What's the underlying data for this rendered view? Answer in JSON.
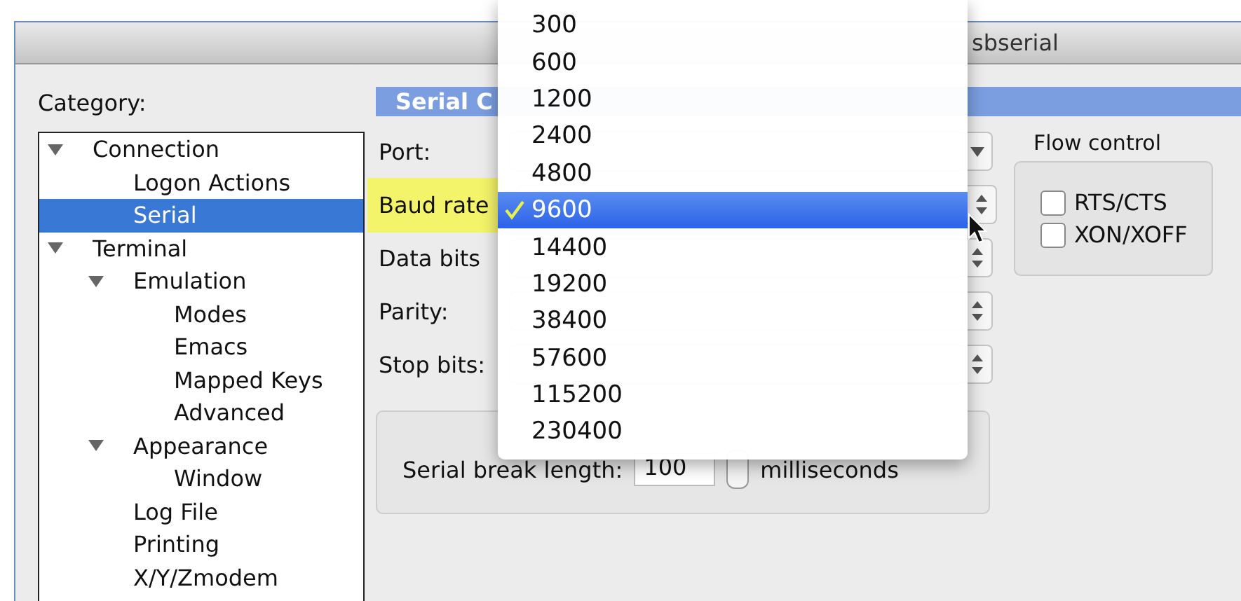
{
  "window": {
    "title": "sbserial"
  },
  "category_label": "Category:",
  "tree": [
    {
      "label": "Connection",
      "expanded": true,
      "selected": false,
      "children": [
        {
          "label": "Logon Actions",
          "selected": false
        },
        {
          "label": "Serial",
          "selected": true
        }
      ]
    },
    {
      "label": "Terminal",
      "expanded": true,
      "selected": false,
      "children": [
        {
          "label": "Emulation",
          "expanded": true,
          "selected": false,
          "children": [
            {
              "label": "Modes",
              "selected": false
            },
            {
              "label": "Emacs",
              "selected": false
            },
            {
              "label": "Mapped Keys",
              "selected": false
            },
            {
              "label": "Advanced",
              "selected": false
            }
          ]
        },
        {
          "label": "Appearance",
          "expanded": true,
          "selected": false,
          "children": [
            {
              "label": "Window",
              "selected": false
            }
          ]
        },
        {
          "label": "Log File",
          "selected": false
        },
        {
          "label": "Printing",
          "selected": false
        },
        {
          "label": "X/Y/Zmodem",
          "selected": false
        }
      ]
    }
  ],
  "section_header": "Serial C",
  "fields": [
    {
      "label": "Port:",
      "kind": "dropdown",
      "highlighted": false
    },
    {
      "label": "Baud rate",
      "kind": "stepper",
      "highlighted": true
    },
    {
      "label": "Data bits",
      "kind": "stepper",
      "highlighted": false
    },
    {
      "label": "Parity:",
      "kind": "stepper",
      "highlighted": false
    },
    {
      "label": "Stop bits:",
      "kind": "stepper",
      "highlighted": false
    }
  ],
  "flow_control": {
    "label": "Flow control",
    "options": [
      {
        "label": "RTS/CTS",
        "checked": false
      },
      {
        "label": "XON/XOFF",
        "checked": false
      }
    ]
  },
  "serial_break": {
    "label": "Serial break length:",
    "value": "100",
    "unit": "milliseconds"
  },
  "baud_menu": [
    {
      "label": "300",
      "selected": false
    },
    {
      "label": "600",
      "selected": false
    },
    {
      "label": "1200",
      "selected": false
    },
    {
      "label": "2400",
      "selected": false
    },
    {
      "label": "4800",
      "selected": false
    },
    {
      "label": "9600",
      "selected": true
    },
    {
      "label": "14400",
      "selected": false
    },
    {
      "label": "19200",
      "selected": false
    },
    {
      "label": "38400",
      "selected": false
    },
    {
      "label": "57600",
      "selected": false
    },
    {
      "label": "115200",
      "selected": false
    },
    {
      "label": "230400",
      "selected": false
    }
  ]
}
